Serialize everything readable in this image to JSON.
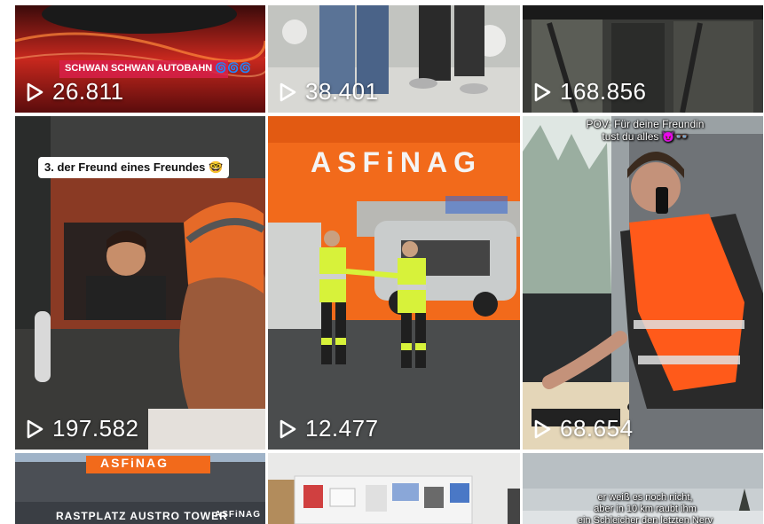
{
  "grid": {
    "tiles": [
      {
        "id": "t1",
        "views": "26.811",
        "caption": "SCHWAN SCHWAN AUTOBAHN 🌀🌀🌀"
      },
      {
        "id": "t2",
        "views": "38.401",
        "caption": ""
      },
      {
        "id": "t3",
        "views": "168.856",
        "caption": ""
      },
      {
        "id": "t4",
        "views": "197.582",
        "caption": "3. der Freund eines Freundes 🤓"
      },
      {
        "id": "t5",
        "views": "12.477",
        "caption": "",
        "sign": "ASFiNAG"
      },
      {
        "id": "t6",
        "views": "68.654",
        "caption_line1": "POV: Für deine Freundin",
        "caption_line2": "tust du alles 😈👓"
      },
      {
        "id": "t7",
        "sign_top": "ASFiNAG",
        "sign_bottom": "RASTPLATZ AUSTRO TOWER",
        "sign_brand": "ASFiNAG"
      },
      {
        "id": "t8"
      },
      {
        "id": "t9",
        "caption_line1": "er weiß es noch nicht,",
        "caption_line2": "aber in 10 km raubt ihm",
        "caption_line3": "ein Schleicher den letzten Nerv"
      }
    ]
  },
  "colors": {
    "orange": "#f26a1b",
    "vest": "#ff5a1a",
    "hiviz": "#d7f23a"
  }
}
